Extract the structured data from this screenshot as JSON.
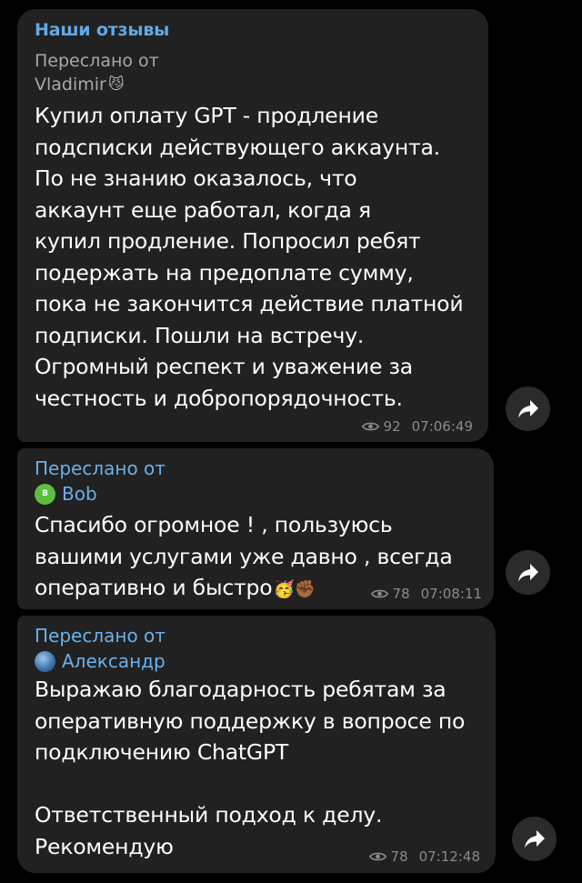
{
  "messages": [
    {
      "channel": "Наши отзывы",
      "forwarded_label": "Переслано от",
      "sender": "Vladimir",
      "sender_emoji": "😼",
      "text": "Купил оплату GPT - продление\nподсписки действующего аккаунта.\nПо не знанию оказалось, что\nаккаунт еще работал, когда я\nкупил продление. Попросил ребят\nподержать на предоплате сумму,\nпока не закончится действие платной\nподписки. Пошли на встречу.\nОгромный респект и уважение за\nчестность и добропорядочность.",
      "views": "92",
      "time": "07:06:49"
    },
    {
      "forwarded_label": "Переслано от",
      "sender": "Bob",
      "avatar_letter": "B",
      "text": "Спасибо огромное ! , пользуюсь\nвашими услугами уже давно , всегда\nоперативно и быстро",
      "text_emoji": "🥳✊🏾",
      "views": "78",
      "time": "07:08:11"
    },
    {
      "forwarded_label": "Переслано от",
      "sender": "Александр",
      "text": "Выражаю благодарность ребятам за\nоперативную поддержку в вопросе по\nподключению ChatGPT\n\nОтветственный подход к делу.\nРекомендую",
      "views": "78",
      "time": "07:12:48"
    }
  ],
  "icons": {
    "share": "share-arrow-icon",
    "views": "eye-icon",
    "avatar_globe": "globe-avatar"
  },
  "colors": {
    "background": "#000000",
    "bubble": "#212121",
    "accent": "#63a9e5",
    "meta": "#8a8a8a"
  }
}
